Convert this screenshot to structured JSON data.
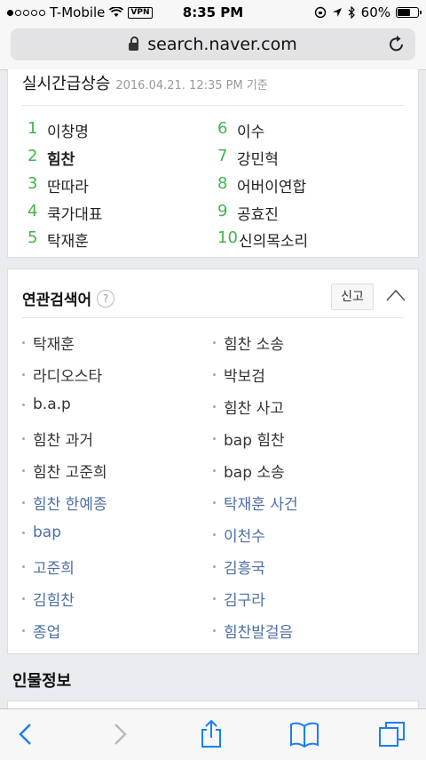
{
  "status_bar": {
    "carrier": "T-Mobile",
    "vpn": "VPN",
    "time": "8:35 PM",
    "battery": "60%",
    "battery_level": 0.6
  },
  "address_bar": {
    "url": "search.naver.com"
  },
  "realtime": {
    "title": "실시간급상승",
    "timestamp": "2016.04.21. 12:35 PM 기준",
    "items": [
      {
        "rank": "1",
        "text": "이창명"
      },
      {
        "rank": "2",
        "text": "힘찬"
      },
      {
        "rank": "3",
        "text": "딴따라"
      },
      {
        "rank": "4",
        "text": "쿡가대표"
      },
      {
        "rank": "5",
        "text": "탁재훈"
      },
      {
        "rank": "6",
        "text": "이수"
      },
      {
        "rank": "7",
        "text": "강민혁"
      },
      {
        "rank": "8",
        "text": "어버이연합"
      },
      {
        "rank": "9",
        "text": "공효진"
      },
      {
        "rank": "10",
        "text": "신의목소리"
      }
    ]
  },
  "related": {
    "title": "연관검색어",
    "help": "?",
    "report": "신고",
    "left": [
      "탁재훈",
      "라디오스타",
      "b.a.p",
      "힘찬 과거",
      "힘찬 고준희",
      "힘찬 한예종",
      "bap",
      "고준희",
      "김힘찬",
      "종업"
    ],
    "right": [
      "힘찬 소송",
      "박보검",
      "힘찬 사고",
      "bap 힘찬",
      "bap 소송",
      "탁재훈 사건",
      "이천수",
      "김흥국",
      "김구라",
      "힘찬발걸음"
    ]
  },
  "person_section": {
    "title": "인물정보"
  },
  "colors": {
    "rank_green": "#3fb64b",
    "link_blue": "#4d6fa5",
    "ios_blue": "#1a7ef5"
  }
}
